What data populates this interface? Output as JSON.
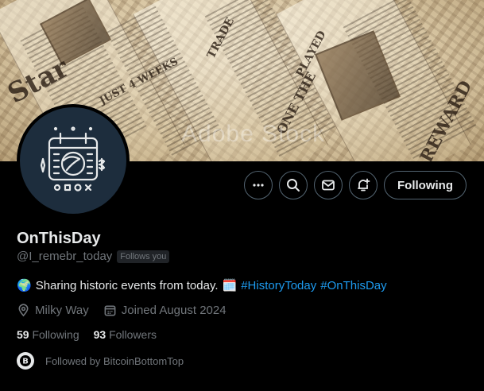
{
  "banner": {
    "watermark": "Adobe Stock",
    "headlines": [
      "Star",
      "REWARD",
      "JUST 4 WEEKS",
      "ONE THE",
      "PLAYED",
      "TRADE"
    ]
  },
  "profile": {
    "display_name": "OnThisDay",
    "handle": "@I_remebr_today",
    "follows_you_label": "Follows you",
    "bio_emoji_globe": "🌍",
    "bio_text": "Sharing historic events from today.",
    "bio_emoji_calendar": "🗓️",
    "hashtag_1": "#HistoryToday",
    "hashtag_2": "#OnThisDay",
    "location": "Milky Way",
    "joined": "Joined August 2024",
    "following_count": "59",
    "following_label": "Following",
    "followers_count": "93",
    "followers_label": "Followers",
    "followed_by_text": "Followed by BitcoinBottomTop"
  },
  "actions": {
    "follow_state_label": "Following",
    "icons": [
      "more-icon",
      "search-icon",
      "message-icon",
      "notification-bell-icon"
    ]
  },
  "colors": {
    "accent": "#1d9bf0",
    "muted": "#71767b",
    "text": "#e7e9ea",
    "background": "#000000"
  }
}
